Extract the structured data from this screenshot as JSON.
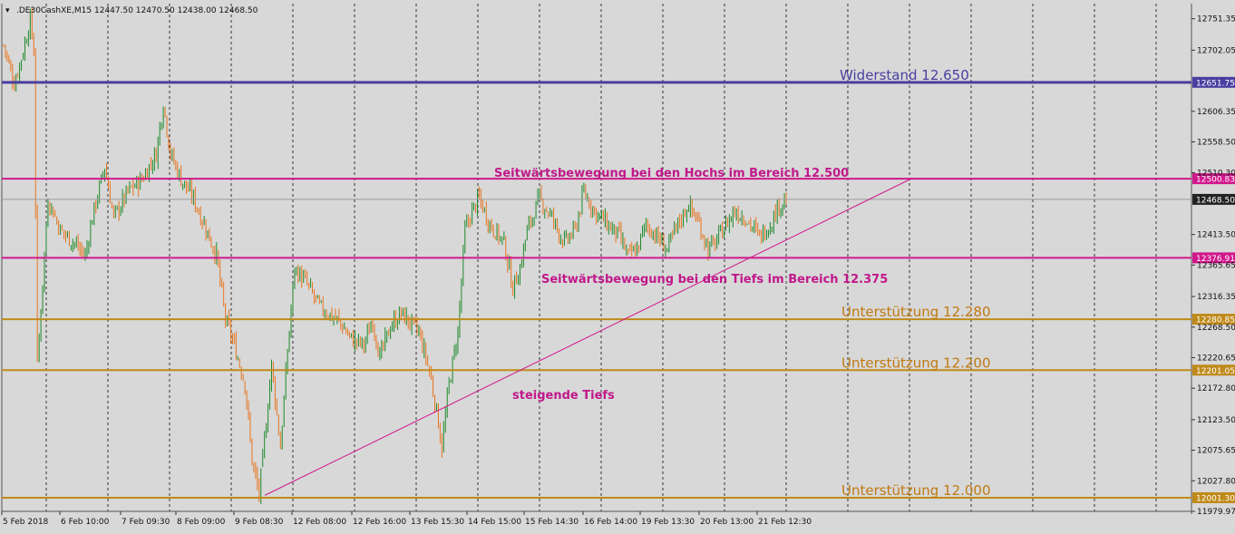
{
  "header": {
    "menu_glyph": "▾",
    "symbol_info": ".DE30CashXE,M15",
    "ohlc": "12447.50 12470.50 12438.00 12468.50"
  },
  "colors": {
    "background": "#d8d8d8",
    "grid": "#333333",
    "bull": "#1e8a2a",
    "bear": "#e8741e",
    "resistance": "#4a3fa0",
    "support": "#c08a1a",
    "range": "#d0188c",
    "trendline": "#d0188c"
  },
  "chart_data": {
    "type": "candlestick",
    "y_scale": {
      "min": 11979.97,
      "max": 12775.0
    },
    "price_ticks": [
      "12751.35",
      "12702.05",
      "12606.35",
      "12558.50",
      "12510.30",
      "12413.50",
      "12365.65",
      "12316.35",
      "12268.50",
      "12220.65",
      "12172.80",
      "12123.50",
      "12075.65",
      "12027.80",
      "11979.97"
    ],
    "time_labels": [
      "5 Feb 2018",
      "6 Feb 10:00",
      "7 Feb 09:30",
      "8 Feb 09:00",
      "9 Feb 08:30",
      "12 Feb 08:00",
      "12 Feb 16:00",
      "13 Feb 15:30",
      "14 Feb 15:00",
      "15 Feb 14:30",
      "16 Feb 14:00",
      "19 Feb 13:30",
      "20 Feb 13:00",
      "21 Feb 12:30"
    ],
    "levels": [
      {
        "price": 12651.75,
        "tag": "12651.75",
        "label": "Widerstand 12.650",
        "kind": "resistance"
      },
      {
        "price": 12500.83,
        "tag": "12500.83",
        "label": "",
        "kind": "range"
      },
      {
        "price": 12376.91,
        "tag": "12376.91",
        "label": "",
        "kind": "range"
      },
      {
        "price": 12280.85,
        "tag": "12280.85",
        "label": "Unterstützung 12.280",
        "kind": "support"
      },
      {
        "price": 12201.05,
        "tag": "12201.05",
        "label": "Unterstützung 12.200",
        "kind": "support"
      },
      {
        "price": 12001.3,
        "tag": "12001.30",
        "label": "Unterstützung 12.000",
        "kind": "support"
      }
    ],
    "current_price": {
      "price": 12468.5,
      "tag": "12468.50"
    },
    "annotations": {
      "highs": "Seitwärtsbewegung bei den Hochs im Bereich 12.500",
      "lows": "Seitwärtsbewegung bei den Tiefs im Bereich 12.375",
      "rising": "steigende Tiefs"
    },
    "trendline": {
      "from_price": 12005.0,
      "to_price": 12500.83
    },
    "path": [
      [
        0,
        12710
      ],
      [
        6,
        12650
      ],
      [
        11,
        12700
      ],
      [
        15,
        12750
      ],
      [
        17,
        12700
      ],
      [
        19,
        12210
      ],
      [
        25,
        12470
      ],
      [
        32,
        12420
      ],
      [
        40,
        12400
      ],
      [
        46,
        12380
      ],
      [
        50,
        12440
      ],
      [
        57,
        12520
      ],
      [
        62,
        12440
      ],
      [
        70,
        12480
      ],
      [
        78,
        12500
      ],
      [
        86,
        12540
      ],
      [
        90,
        12620
      ],
      [
        94,
        12540
      ],
      [
        100,
        12500
      ],
      [
        107,
        12470
      ],
      [
        113,
        12430
      ],
      [
        120,
        12380
      ],
      [
        125,
        12280
      ],
      [
        130,
        12240
      ],
      [
        136,
        12180
      ],
      [
        140,
        12060
      ],
      [
        144,
        12005
      ],
      [
        148,
        12120
      ],
      [
        151,
        12210
      ],
      [
        156,
        12080
      ],
      [
        160,
        12230
      ],
      [
        164,
        12360
      ],
      [
        170,
        12340
      ],
      [
        178,
        12300
      ],
      [
        188,
        12280
      ],
      [
        196,
        12250
      ],
      [
        203,
        12240
      ],
      [
        208,
        12280
      ],
      [
        212,
        12220
      ],
      [
        218,
        12270
      ],
      [
        224,
        12290
      ],
      [
        234,
        12260
      ],
      [
        240,
        12200
      ],
      [
        245,
        12120
      ],
      [
        247,
        12080
      ],
      [
        251,
        12180
      ],
      [
        256,
        12260
      ],
      [
        260,
        12420
      ],
      [
        264,
        12450
      ],
      [
        268,
        12470
      ],
      [
        274,
        12430
      ],
      [
        282,
        12400
      ],
      [
        287,
        12330
      ],
      [
        291,
        12360
      ],
      [
        295,
        12420
      ],
      [
        302,
        12470
      ],
      [
        309,
        12440
      ],
      [
        316,
        12400
      ],
      [
        322,
        12420
      ],
      [
        327,
        12480
      ],
      [
        333,
        12450
      ],
      [
        340,
        12430
      ],
      [
        347,
        12410
      ],
      [
        352,
        12380
      ],
      [
        357,
        12390
      ],
      [
        362,
        12430
      ],
      [
        368,
        12410
      ],
      [
        374,
        12390
      ],
      [
        380,
        12430
      ],
      [
        386,
        12460
      ],
      [
        392,
        12430
      ],
      [
        397,
        12390
      ],
      [
        401,
        12400
      ],
      [
        405,
        12420
      ],
      [
        412,
        12450
      ],
      [
        418,
        12440
      ],
      [
        426,
        12410
      ],
      [
        432,
        12430
      ],
      [
        437,
        12460
      ],
      [
        441,
        12468
      ]
    ]
  }
}
